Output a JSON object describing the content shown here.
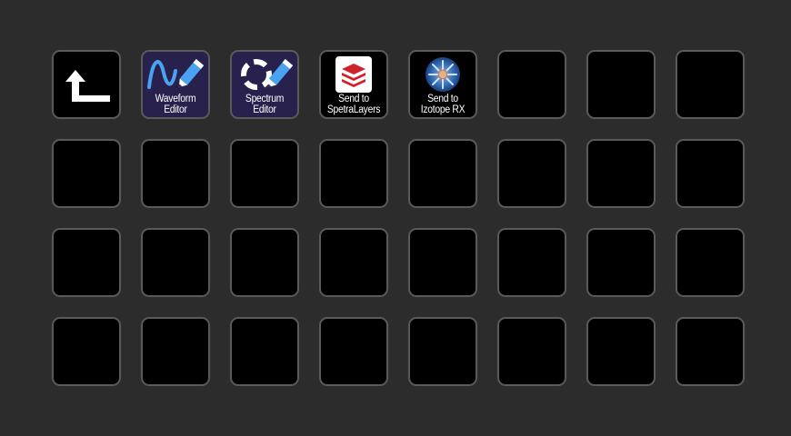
{
  "keys": [
    {
      "id": "back",
      "icon": "back-arrow-icon"
    },
    {
      "id": "waveform-editor",
      "icon": "waveform-pencil-icon",
      "lines": [
        "Waveform",
        "Editor"
      ],
      "bg": "#28214d"
    },
    {
      "id": "spectrum-editor",
      "icon": "spectrum-pencil-icon",
      "lines": [
        "Spectrum",
        "Editor"
      ],
      "bg": "#28214d"
    },
    {
      "id": "send-spectralayers",
      "icon": "spectralayers-logo-icon",
      "lines": [
        "Send to",
        "SpetraLayers"
      ]
    },
    {
      "id": "send-izotope-rx",
      "icon": "izotope-rx-logo-icon",
      "lines": [
        "Send to",
        "Izotope RX"
      ]
    }
  ],
  "grid": {
    "columns": 8,
    "rows": 4
  },
  "colors": {
    "background": "#2c2c2c",
    "key_border": "#5a5a5a",
    "key_fill": "#000000",
    "purple_key": "#28214d",
    "accent_blue": "#4aa3f0",
    "spectralayers_red": "#d0202a"
  }
}
